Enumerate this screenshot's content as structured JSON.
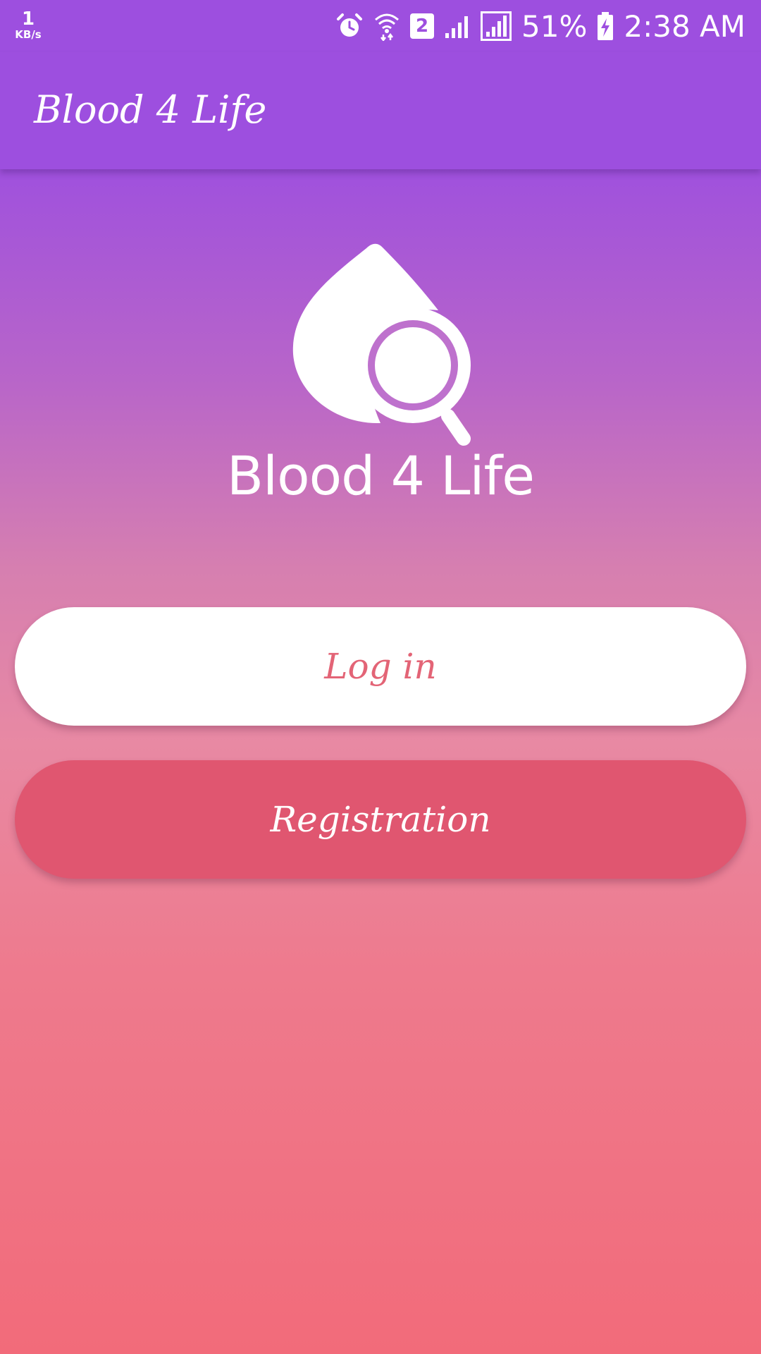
{
  "status_bar": {
    "net_speed_value": "1",
    "net_speed_unit": "KB/s",
    "sim_slot": "2",
    "battery_percent": "51%",
    "time": "2:38 AM",
    "icons": [
      "alarm-icon",
      "wifi-icon",
      "sim-icon",
      "signal-icon",
      "signal-full-icon",
      "battery-charging-icon"
    ]
  },
  "app_bar": {
    "title": "Blood 4 Life"
  },
  "logo": {
    "wordmark": "Blood 4 Life",
    "icon": "blood-drop-magnifier-icon"
  },
  "buttons": {
    "login_label": "Log in",
    "register_label": "Registration"
  },
  "colors": {
    "primary": "#9d4fdf",
    "accent": "#e05670",
    "login_text": "#e36476",
    "gradient_bottom": "#f26b7a"
  }
}
